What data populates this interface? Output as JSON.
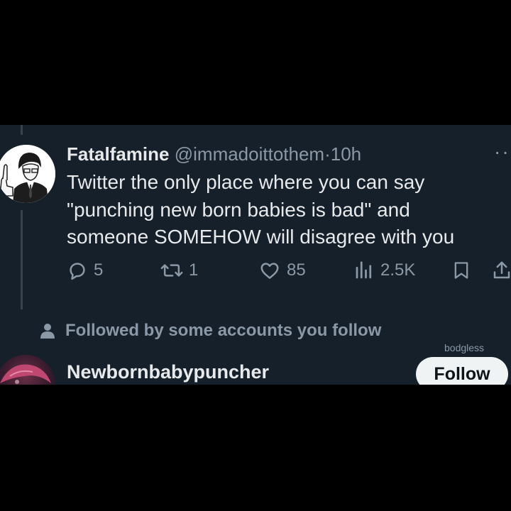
{
  "tweet": {
    "display_name": "Fatalfamine",
    "handle": "@immadoittothem",
    "separator": "·",
    "time": "10h",
    "more_icon": "more-icon",
    "lines": [
      "Twitter the only place where you can say",
      "\"punching new born babies is bad\" and",
      "someone SOMEHOW will disagree with you"
    ],
    "actions": {
      "reply": {
        "icon": "reply-icon",
        "count": "5"
      },
      "retweet": {
        "icon": "retweet-icon",
        "count": "1"
      },
      "like": {
        "icon": "heart-icon",
        "count": "85"
      },
      "views": {
        "icon": "views-icon",
        "count": "2.5K"
      },
      "bookmark": {
        "icon": "bookmark-icon"
      },
      "share": {
        "icon": "share-icon"
      }
    }
  },
  "social_context": {
    "icon": "person-icon",
    "text": "Followed by some accounts you follow"
  },
  "watermark": "bodgless",
  "suggested_user": {
    "name": "Newbornbabypuncher",
    "follow_label": "Follow"
  },
  "colors": {
    "background": "#15202b",
    "primary_text": "#e7e9ea",
    "secondary_text": "#8b98a5",
    "button_bg": "#eff3f4"
  }
}
